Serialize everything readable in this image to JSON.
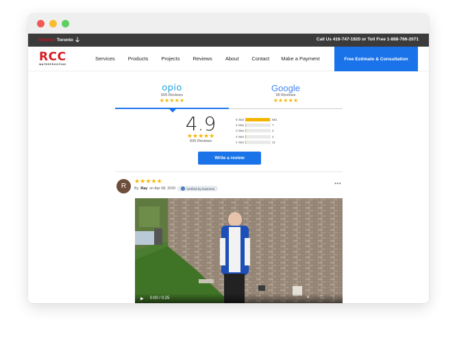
{
  "topbar": {
    "location_prefix": "Choose",
    "location": "Toronto",
    "call_text": "Call Us 416-747-1920 or Toll Free 1-888-766-2071"
  },
  "logo": {
    "name": "RCC",
    "tagline": "WATERPROOFING"
  },
  "nav": {
    "items": [
      "Services",
      "Products",
      "Projects",
      "Reviews",
      "About",
      "Contact",
      "Make a Payment"
    ],
    "cta": "Free Estimate & Consultation"
  },
  "tabs": {
    "opio": {
      "brand": "opio",
      "count": "605 Reviews",
      "stars": "★★★★★"
    },
    "google": {
      "brand": "Google",
      "count": "96 Reviews",
      "stars": "★★★★★"
    }
  },
  "summary": {
    "score": "4.9",
    "stars": "★★★★★",
    "count": "605 Reviews",
    "breakdown": [
      {
        "label": "5 Star",
        "count": "581",
        "fraction": 0.96
      },
      {
        "label": "4 Star",
        "count": "7",
        "fraction": 0.012
      },
      {
        "label": "3 Star",
        "count": "2",
        "fraction": 0.004
      },
      {
        "label": "2 Star",
        "count": "4",
        "fraction": 0.007
      },
      {
        "label": "1 Star",
        "count": "11",
        "fraction": 0.018
      }
    ],
    "write_button": "Write a review"
  },
  "review": {
    "initial": "R",
    "stars": "★★★★★",
    "by": "By",
    "author": "Ray",
    "date": "on Apr 08, 2020",
    "badge": "Verified by business",
    "more": "•••",
    "video_time": "0:00 / 0:25"
  },
  "colors": {
    "brand_red": "#d51b24",
    "accent_blue": "#1a73e8",
    "star_gold": "#f5b400",
    "topbar_bg": "#3b3b3b"
  }
}
